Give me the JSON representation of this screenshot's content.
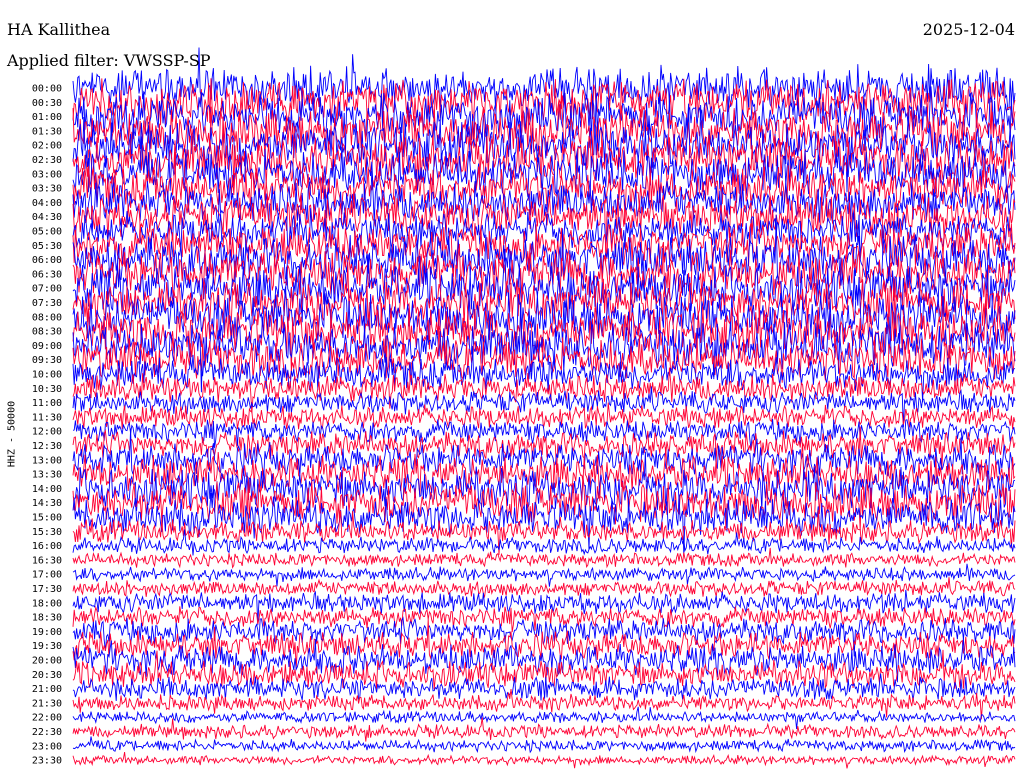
{
  "header": {
    "station": "HA Kallithea",
    "filter": "Applied filter: VWSSP-SP",
    "date": "2025-12-04"
  },
  "colors": {
    "trace_a": "#0000ff",
    "trace_b": "#ff0033",
    "background": "#ffffff"
  },
  "chart_data": {
    "type": "line",
    "title": "HA Kallithea",
    "subtitle": "Applied filter: VWSSP-SP",
    "ylabel": "HHZ - 50000",
    "xlabel": "",
    "row_labels": [
      "00:00",
      "00:30",
      "01:00",
      "01:30",
      "02:00",
      "02:30",
      "03:00",
      "03:30",
      "04:00",
      "04:30",
      "05:00",
      "05:30",
      "06:00",
      "06:30",
      "07:00",
      "07:30",
      "08:00",
      "08:30",
      "09:00",
      "09:30",
      "10:00",
      "10:30",
      "11:00",
      "11:30",
      "12:00",
      "12:30",
      "13:00",
      "13:30",
      "14:00",
      "14:30",
      "15:00",
      "15:30",
      "16:00",
      "16:30",
      "17:00",
      "17:30",
      "18:00",
      "18:30",
      "19:00",
      "19:30",
      "20:00",
      "20:30",
      "21:00",
      "21:30",
      "22:00",
      "22:30",
      "23:00",
      "23:30"
    ],
    "row_colors": [
      "trace_a",
      "trace_b"
    ],
    "relative_amplitude": [
      0.9,
      1.0,
      1.0,
      1.0,
      1.0,
      1.0,
      1.0,
      0.9,
      0.9,
      0.9,
      0.8,
      0.9,
      1.0,
      1.0,
      1.0,
      1.0,
      1.0,
      1.0,
      1.0,
      0.9,
      0.7,
      0.6,
      0.5,
      0.5,
      0.5,
      0.6,
      0.7,
      0.8,
      0.9,
      0.9,
      0.8,
      0.5,
      0.35,
      0.3,
      0.3,
      0.35,
      0.45,
      0.45,
      0.55,
      0.6,
      0.65,
      0.6,
      0.5,
      0.35,
      0.25,
      0.3,
      0.25,
      0.2
    ],
    "grid": false
  }
}
